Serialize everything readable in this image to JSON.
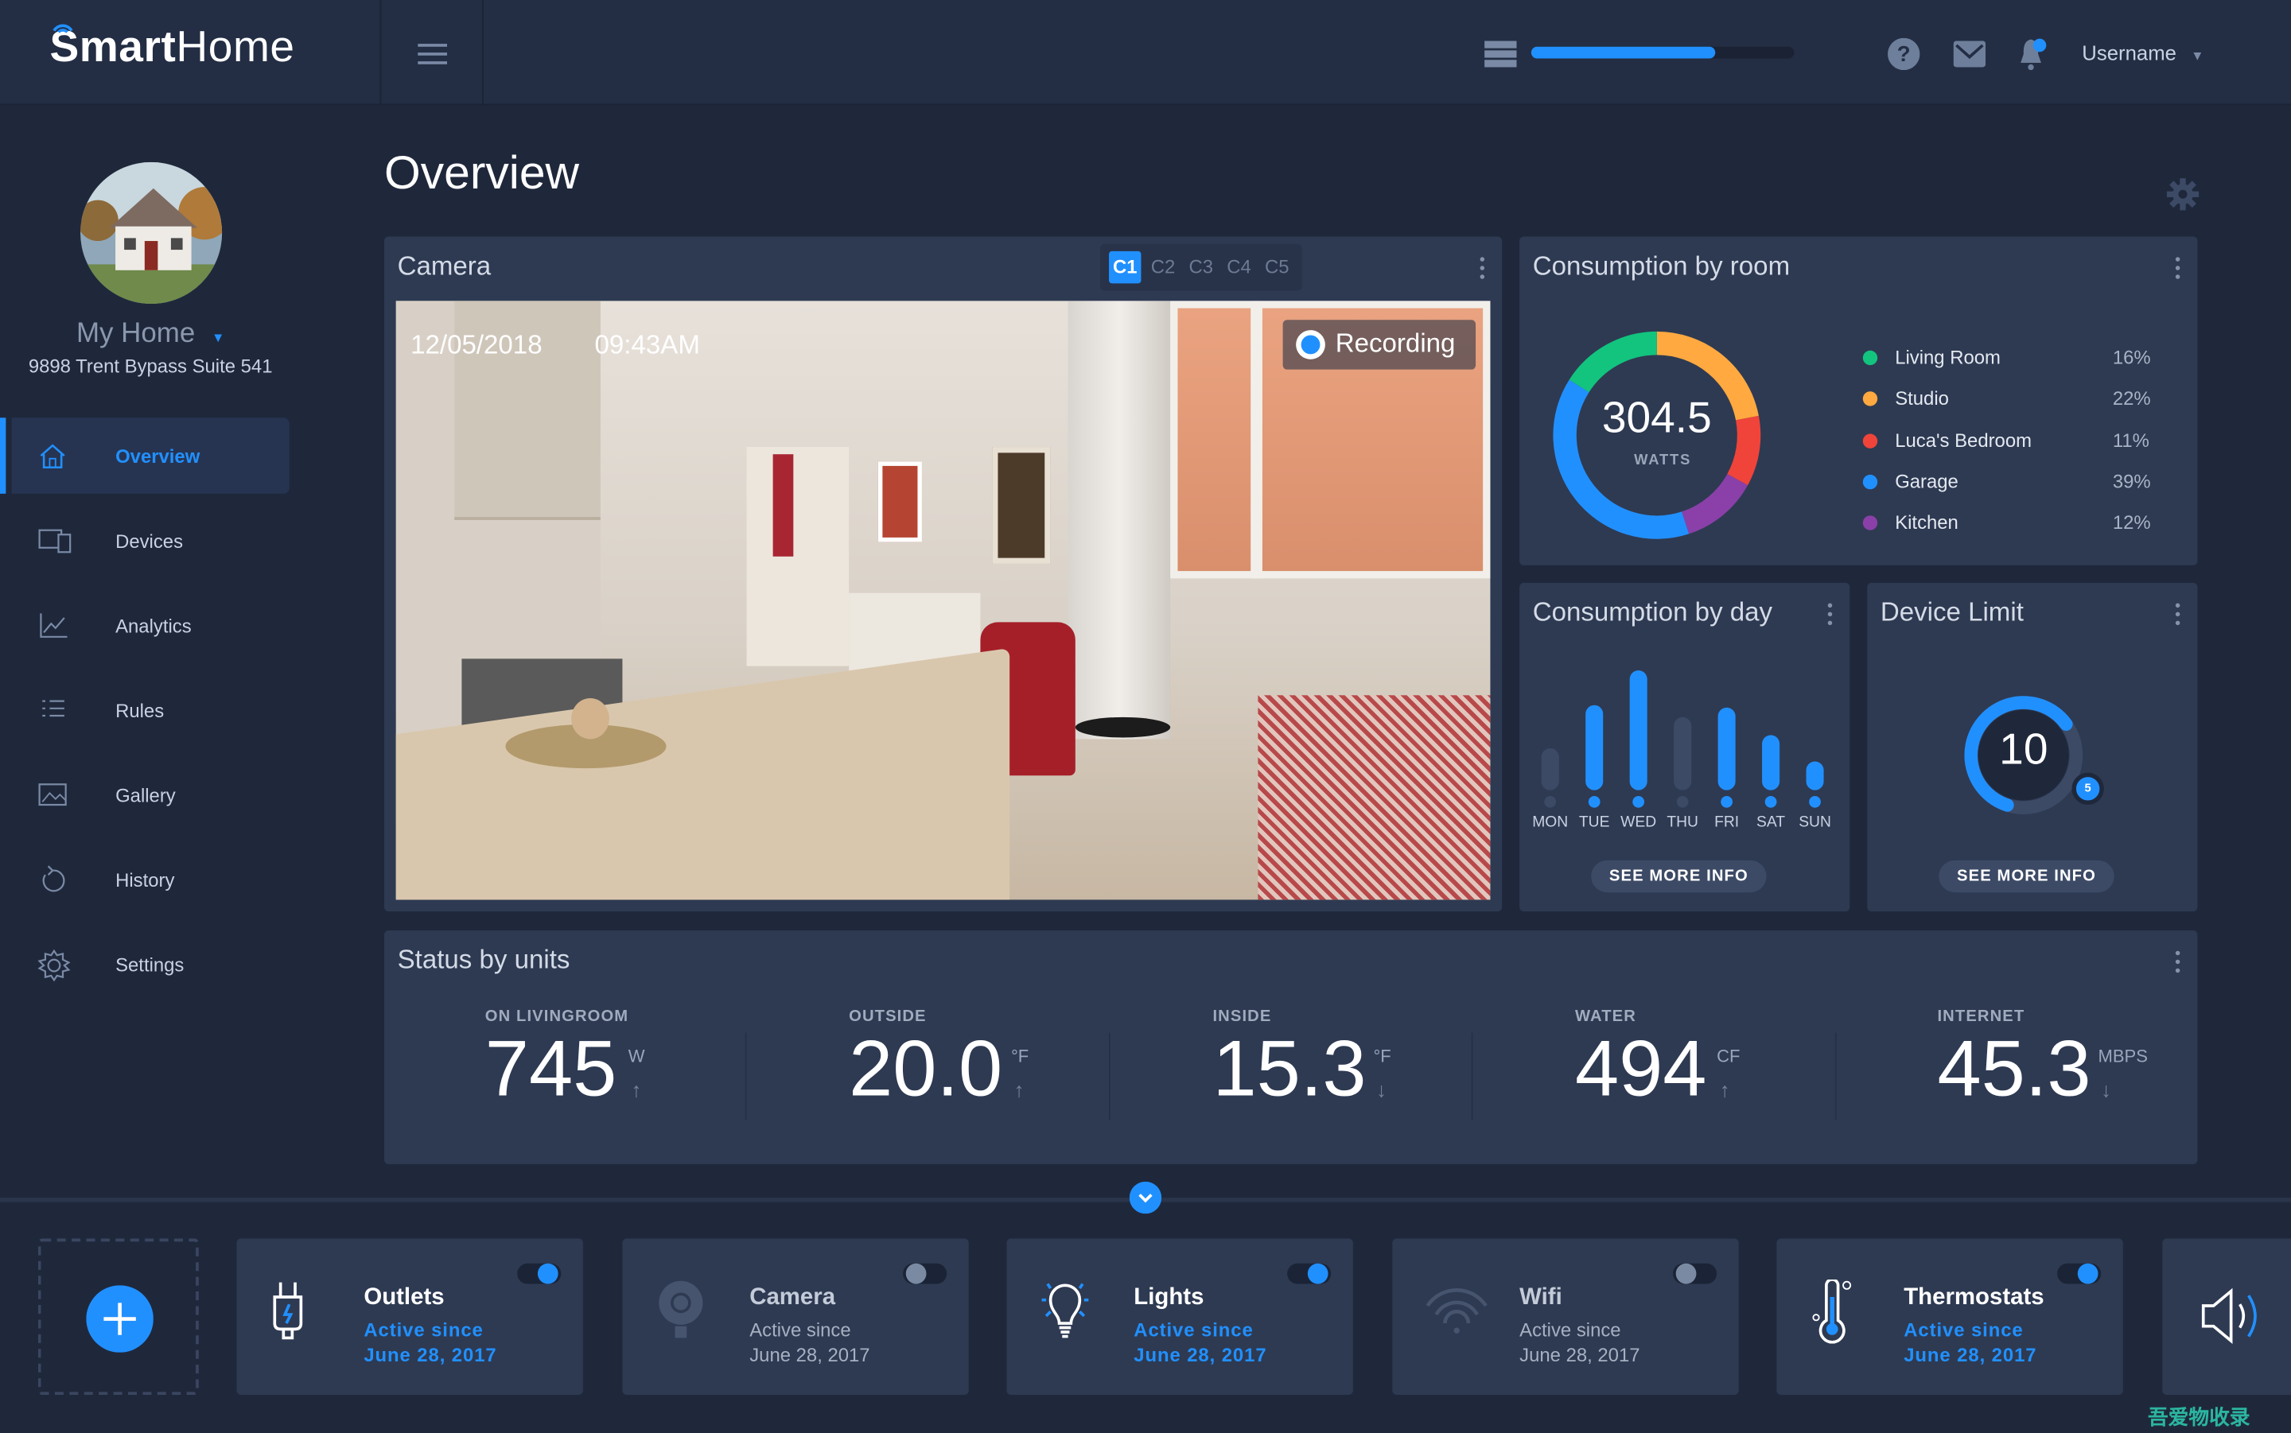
{
  "app": {
    "logo_bold": "Smart",
    "logo_light": "Home"
  },
  "header": {
    "storage_progress": 0.7,
    "username": "Username",
    "icons": [
      "menu-icon",
      "server-icon",
      "help-icon",
      "mail-icon",
      "bell-icon"
    ]
  },
  "profile": {
    "name": "My Home",
    "address": "9898 Trent Bypass Suite 541"
  },
  "sidebar": {
    "items": [
      {
        "label": "Overview",
        "icon": "home-icon",
        "active": true
      },
      {
        "label": "Devices",
        "icon": "devices-icon"
      },
      {
        "label": "Analytics",
        "icon": "chart-icon"
      },
      {
        "label": "Rules",
        "icon": "list-icon"
      },
      {
        "label": "Gallery",
        "icon": "gallery-icon"
      },
      {
        "label": "History",
        "icon": "history-icon"
      },
      {
        "label": "Settings",
        "icon": "gear-icon"
      }
    ]
  },
  "page": {
    "title": "Overview"
  },
  "camera": {
    "title": "Camera",
    "tabs": [
      "C1",
      "C2",
      "C3",
      "C4",
      "C5"
    ],
    "active_tab": "C1",
    "date": "12/05/2018",
    "time": "09:43AM",
    "recording": "Recording"
  },
  "consumption_room": {
    "title": "Consumption by room",
    "total": "304.5",
    "unit": "WATTS",
    "rooms": [
      {
        "name": "Living Room",
        "pct": "16%",
        "value": 16,
        "color": "#12c47e"
      },
      {
        "name": "Studio",
        "pct": "22%",
        "value": 22,
        "color": "#ffa940"
      },
      {
        "name": "Luca's Bedroom",
        "pct": "11%",
        "value": 11,
        "color": "#f0443a"
      },
      {
        "name": "Garage",
        "pct": "39%",
        "value": 39,
        "color": "#2190ff"
      },
      {
        "name": "Kitchen",
        "pct": "12%",
        "value": 12,
        "color": "#8a40a8"
      }
    ],
    "ring_order": [
      "Studio",
      "Luca's Bedroom",
      "Kitchen",
      "Garage",
      "Living Room"
    ]
  },
  "consumption_day": {
    "title": "Consumption by day",
    "button": "SEE MORE INFO",
    "days": [
      {
        "label": "MON",
        "value": 35,
        "active": false
      },
      {
        "label": "TUE",
        "value": 71,
        "active": true
      },
      {
        "label": "WED",
        "value": 100,
        "active": true
      },
      {
        "label": "THU",
        "value": 61,
        "active": false
      },
      {
        "label": "FRI",
        "value": 69,
        "active": true
      },
      {
        "label": "SAT",
        "value": 46,
        "active": true
      },
      {
        "label": "SUN",
        "value": 24,
        "active": true
      }
    ]
  },
  "device_limit": {
    "title": "Device Limit",
    "value": "10",
    "badge": "5",
    "fill": 0.6,
    "button": "SEE MORE INFO"
  },
  "status": {
    "title": "Status by units",
    "units": [
      {
        "label": "ON LIVINGROOM",
        "value": "745",
        "unit": "W",
        "trend": "↑"
      },
      {
        "label": "OUTSIDE",
        "value": "20.0",
        "unit": "°F",
        "trend": "↑"
      },
      {
        "label": "INSIDE",
        "value": "15.3",
        "unit": "°F",
        "trend": "↓"
      },
      {
        "label": "WATER",
        "value": "494",
        "unit": "CF",
        "trend": "↑"
      },
      {
        "label": "INTERNET",
        "value": "45.3",
        "unit": "MBPS",
        "trend": "↓"
      }
    ]
  },
  "devices": [
    {
      "name": "Outlets",
      "status": "Active since",
      "date": "June 28, 2017",
      "on": true,
      "icon": "outlet-icon"
    },
    {
      "name": "Camera",
      "status": "Active since",
      "date": "June 28, 2017",
      "on": false,
      "icon": "webcam-icon"
    },
    {
      "name": "Lights",
      "status": "Active since",
      "date": "June 28, 2017",
      "on": true,
      "icon": "bulb-icon"
    },
    {
      "name": "Wifi",
      "status": "Active since",
      "date": "June 28, 2017",
      "on": false,
      "icon": "wifi-icon"
    },
    {
      "name": "Thermostats",
      "status": "Active since",
      "date": "June 28, 2017",
      "on": true,
      "icon": "thermometer-icon"
    }
  ],
  "colors": {
    "accent": "#2190ff",
    "background": "#1f283b",
    "card": "#2e3a52"
  },
  "watermark": "吾爱物收录"
}
